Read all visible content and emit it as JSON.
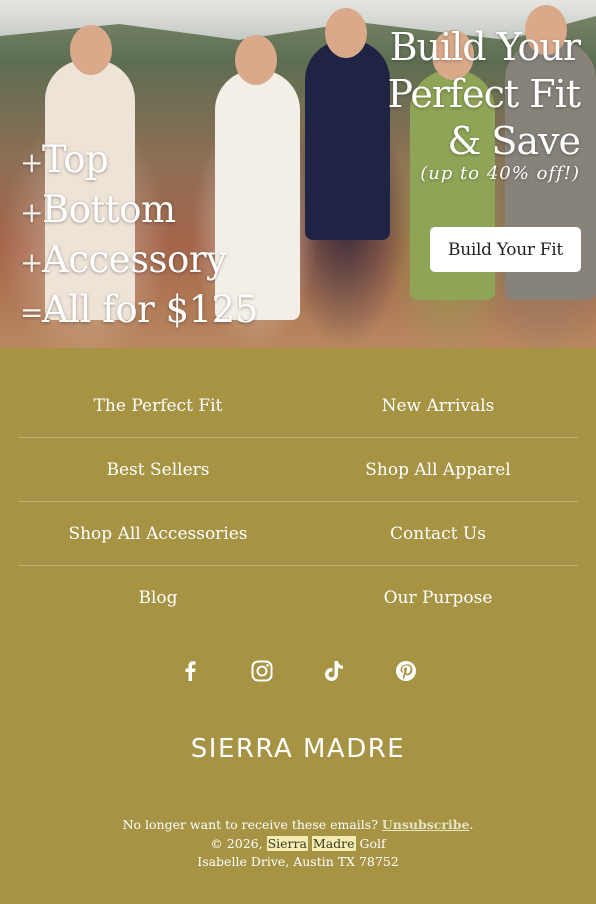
{
  "hero": {
    "left_lines": [
      {
        "symbol": "+",
        "text": "Top"
      },
      {
        "symbol": "+",
        "text": "Bottom"
      },
      {
        "symbol": "+",
        "text": "Accessory"
      },
      {
        "symbol": "=",
        "text": "All for $125"
      }
    ],
    "right_lines": [
      "Build Your",
      "Perfect Fit",
      "& Save"
    ],
    "right_sub": "(up to 40% off!)",
    "cta_label": "Build Your Fit"
  },
  "nav": {
    "rows": [
      [
        "The Perfect Fit",
        "New Arrivals"
      ],
      [
        "Best Sellers",
        "Shop All Apparel"
      ],
      [
        "Shop All Accessories",
        "Contact Us"
      ],
      [
        "Blog",
        "Our Purpose"
      ]
    ]
  },
  "social": {
    "icons": [
      "facebook-icon",
      "instagram-icon",
      "tiktok-icon",
      "pinterest-icon"
    ]
  },
  "brand": {
    "logo_text": "SIERRA MADRE"
  },
  "footer": {
    "unsubscribe_prompt": "No longer want to receive these emails?",
    "unsubscribe_link": "Unsubscribe",
    "period": ".",
    "copyright_prefix": "© 2026,",
    "company_word1": "Sierra",
    "company_word2": "Madre",
    "company_suffix": "Golf",
    "address": "Isabelle Drive, Austin TX 78752"
  },
  "colors": {
    "background": "#a69343",
    "text": "#ffffff",
    "cta_background": "#ffffff"
  }
}
